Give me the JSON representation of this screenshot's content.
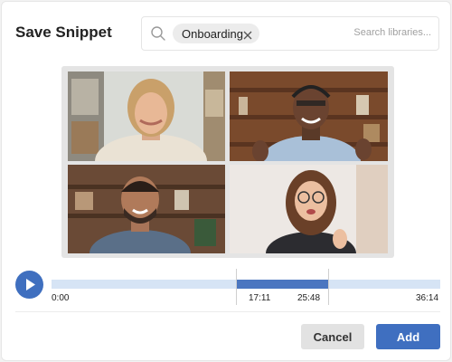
{
  "dialog": {
    "title": "Save Snippet"
  },
  "search": {
    "icon": "search-icon",
    "tag_label": "Onboarding",
    "tag_remove_icon": "close-icon",
    "placeholder": "Search libraries..."
  },
  "video": {
    "participants": [
      "participant-1",
      "participant-2",
      "participant-3",
      "participant-4"
    ]
  },
  "timeline": {
    "play_icon": "play-icon",
    "start_label": "0:00",
    "selection_start_label": "17:11",
    "selection_end_label": "25:48",
    "end_label": "36:14",
    "selection_start_fraction": 0.474,
    "selection_end_fraction": 0.712
  },
  "footer": {
    "cancel_label": "Cancel",
    "add_label": "Add"
  },
  "colors": {
    "accent": "#3f6fc0",
    "track": "#d6e4f5",
    "selection": "#4b76c0"
  }
}
